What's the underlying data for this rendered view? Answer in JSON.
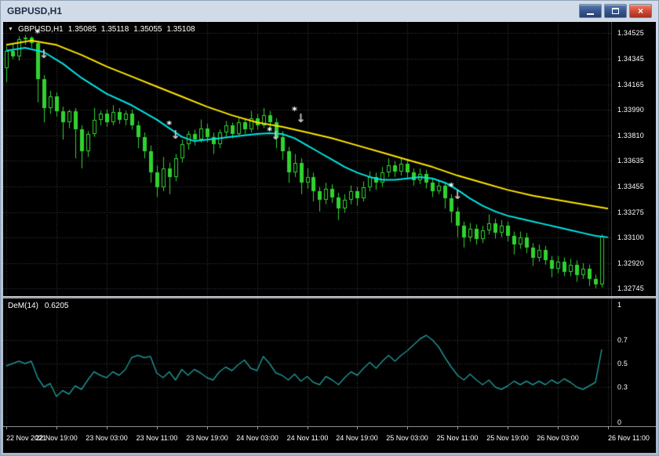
{
  "window": {
    "title": "GBPUSD,H1"
  },
  "icons": {
    "dropdown": "▼",
    "sell_arrow": "↓",
    "signal_star": "*",
    "close": "×"
  },
  "colors": {
    "chart_bg": "#000000",
    "grid": "#3f3f3f",
    "candle": "#30d230",
    "ma_slow": "#ffe400",
    "ma_fast": "#00e5e5",
    "arrow": "#c8c8c8",
    "star": "#ffffff",
    "dem_line": "#1f9090",
    "axis_text": "#ffffff"
  },
  "quote": {
    "symbol": "GBPUSD,H1",
    "open": "1.35085",
    "high": "1.35118",
    "low": "1.35055",
    "close": "1.35108"
  },
  "chart_data": {
    "bars_total": 97,
    "bars_per_label": 8,
    "x_labels": [
      "22 Nov 2021",
      "22 Nov 19:00",
      "23 Nov 03:00",
      "23 Nov 11:00",
      "23 Nov 19:00",
      "24 Nov 03:00",
      "24 Nov 11:00",
      "24 Nov 19:00",
      "25 Nov 03:00",
      "25 Nov 11:00",
      "25 Nov 19:00",
      "26 Nov 03:00",
      "26 Nov 11:00"
    ],
    "main": {
      "type": "candlestick",
      "symbol": "GBPUSD",
      "timeframe": "H1",
      "y_range": [
        1.3269,
        1.346
      ],
      "price_labels": [
        "1.34525",
        "1.34345",
        "1.34165",
        "1.33990",
        "1.33810",
        "1.33635",
        "1.33455",
        "1.33275",
        "1.33100",
        "1.32920",
        "1.32745"
      ],
      "candles": [
        [
          1.3428,
          1.3443,
          1.3418,
          1.344
        ],
        [
          1.344,
          1.3445,
          1.3434,
          1.3436
        ],
        [
          1.3436,
          1.345,
          1.3433,
          1.3448
        ],
        [
          1.3448,
          1.3451,
          1.3444,
          1.3449
        ],
        [
          1.3449,
          1.345,
          1.3442,
          1.3445
        ],
        [
          1.3445,
          1.3447,
          1.3404,
          1.342
        ],
        [
          1.342,
          1.3423,
          1.339,
          1.34
        ],
        [
          1.34,
          1.3412,
          1.3396,
          1.3408
        ],
        [
          1.3408,
          1.3411,
          1.3394,
          1.3398
        ],
        [
          1.3398,
          1.3401,
          1.3378,
          1.339
        ],
        [
          1.339,
          1.3399,
          1.3386,
          1.3398
        ],
        [
          1.3398,
          1.34,
          1.3365,
          1.3385
        ],
        [
          1.3385,
          1.3388,
          1.3358,
          1.337
        ],
        [
          1.337,
          1.3384,
          1.3366,
          1.3382
        ],
        [
          1.3382,
          1.34,
          1.338,
          1.3392
        ],
        [
          1.3392,
          1.3398,
          1.3388,
          1.3396
        ],
        [
          1.3396,
          1.3399,
          1.3387,
          1.339
        ],
        [
          1.339,
          1.3402,
          1.3388,
          1.3397
        ],
        [
          1.3397,
          1.34,
          1.3389,
          1.3392
        ],
        [
          1.3392,
          1.3398,
          1.3388,
          1.3396
        ],
        [
          1.3396,
          1.3399,
          1.3385,
          1.3388
        ],
        [
          1.3388,
          1.3391,
          1.3372,
          1.338
        ],
        [
          1.338,
          1.3383,
          1.3365,
          1.337
        ],
        [
          1.337,
          1.3374,
          1.3348,
          1.3355
        ],
        [
          1.3355,
          1.336,
          1.3338,
          1.3345
        ],
        [
          1.3345,
          1.3366,
          1.3342,
          1.3358
        ],
        [
          1.3358,
          1.3362,
          1.334,
          1.3352
        ],
        [
          1.3352,
          1.3368,
          1.3349,
          1.3365
        ],
        [
          1.3365,
          1.3378,
          1.3362,
          1.3375
        ],
        [
          1.3375,
          1.3384,
          1.3371,
          1.3382
        ],
        [
          1.3382,
          1.3385,
          1.3374,
          1.3378
        ],
        [
          1.3378,
          1.3392,
          1.3376,
          1.3386
        ],
        [
          1.3386,
          1.3389,
          1.3376,
          1.338
        ],
        [
          1.338,
          1.3383,
          1.3368,
          1.3375
        ],
        [
          1.3375,
          1.3385,
          1.3372,
          1.3383
        ],
        [
          1.3383,
          1.3391,
          1.338,
          1.3388
        ],
        [
          1.3388,
          1.339,
          1.3379,
          1.3382
        ],
        [
          1.3382,
          1.3393,
          1.338,
          1.339
        ],
        [
          1.339,
          1.3393,
          1.3382,
          1.3385
        ],
        [
          1.3385,
          1.3398,
          1.3383,
          1.3393
        ],
        [
          1.3393,
          1.3396,
          1.3385,
          1.3388
        ],
        [
          1.3388,
          1.34,
          1.3386,
          1.3395
        ],
        [
          1.3395,
          1.3398,
          1.3386,
          1.339
        ],
        [
          1.339,
          1.3393,
          1.3372,
          1.338
        ],
        [
          1.338,
          1.3384,
          1.3364,
          1.337
        ],
        [
          1.337,
          1.3373,
          1.3348,
          1.3355
        ],
        [
          1.3355,
          1.3368,
          1.3352,
          1.3362
        ],
        [
          1.3362,
          1.3365,
          1.334,
          1.3348
        ],
        [
          1.3348,
          1.3358,
          1.3344,
          1.3352
        ],
        [
          1.3352,
          1.3355,
          1.3335,
          1.3342
        ],
        [
          1.3342,
          1.3345,
          1.3328,
          1.3336
        ],
        [
          1.3336,
          1.3348,
          1.3333,
          1.3344
        ],
        [
          1.3344,
          1.3347,
          1.3334,
          1.3338
        ],
        [
          1.3338,
          1.3341,
          1.3322,
          1.333
        ],
        [
          1.333,
          1.334,
          1.3327,
          1.3336
        ],
        [
          1.3336,
          1.3346,
          1.3333,
          1.3342
        ],
        [
          1.3342,
          1.3345,
          1.3332,
          1.3337
        ],
        [
          1.3337,
          1.3349,
          1.3335,
          1.3345
        ],
        [
          1.3345,
          1.3356,
          1.3342,
          1.3352
        ],
        [
          1.3352,
          1.3355,
          1.3343,
          1.3348
        ],
        [
          1.3348,
          1.3359,
          1.3345,
          1.3355
        ],
        [
          1.3355,
          1.3365,
          1.3352,
          1.336
        ],
        [
          1.336,
          1.3363,
          1.3352,
          1.3356
        ],
        [
          1.3356,
          1.3365,
          1.3353,
          1.3361
        ],
        [
          1.3361,
          1.3364,
          1.3351,
          1.3355
        ],
        [
          1.3355,
          1.3358,
          1.3346,
          1.335
        ],
        [
          1.335,
          1.3358,
          1.3347,
          1.3354
        ],
        [
          1.3354,
          1.3357,
          1.3344,
          1.3348
        ],
        [
          1.3348,
          1.3351,
          1.3338,
          1.3342
        ],
        [
          1.3342,
          1.335,
          1.334,
          1.3346
        ],
        [
          1.3346,
          1.3348,
          1.333,
          1.3337
        ],
        [
          1.3337,
          1.334,
          1.332,
          1.3328
        ],
        [
          1.3328,
          1.3331,
          1.331,
          1.3318
        ],
        [
          1.3318,
          1.3321,
          1.3303,
          1.331
        ],
        [
          1.331,
          1.332,
          1.3307,
          1.3316
        ],
        [
          1.3316,
          1.3319,
          1.3305,
          1.3309
        ],
        [
          1.3309,
          1.3318,
          1.3306,
          1.3315
        ],
        [
          1.3315,
          1.3326,
          1.3312,
          1.332
        ],
        [
          1.332,
          1.3323,
          1.3309,
          1.3313
        ],
        [
          1.3313,
          1.3322,
          1.331,
          1.3318
        ],
        [
          1.3318,
          1.3321,
          1.3307,
          1.3311
        ],
        [
          1.3311,
          1.3314,
          1.3298,
          1.3305
        ],
        [
          1.3305,
          1.3314,
          1.3302,
          1.331
        ],
        [
          1.331,
          1.3313,
          1.3299,
          1.3303
        ],
        [
          1.3303,
          1.3306,
          1.329,
          1.3296
        ],
        [
          1.3296,
          1.3305,
          1.3293,
          1.3301
        ],
        [
          1.3301,
          1.3304,
          1.3291,
          1.3294
        ],
        [
          1.3294,
          1.3297,
          1.3282,
          1.3288
        ],
        [
          1.3288,
          1.3297,
          1.3285,
          1.3293
        ],
        [
          1.3293,
          1.3296,
          1.3283,
          1.3286
        ],
        [
          1.3286,
          1.3295,
          1.3283,
          1.3291
        ],
        [
          1.3291,
          1.3294,
          1.3279,
          1.3284
        ],
        [
          1.3284,
          1.3292,
          1.3281,
          1.3288
        ],
        [
          1.3288,
          1.3291,
          1.3276,
          1.3281
        ],
        [
          1.3281,
          1.3284,
          1.32745,
          1.3277
        ],
        [
          1.3277,
          1.3312,
          1.3275,
          1.33108
        ]
      ],
      "overlays": [
        {
          "name": "MA slow (yellow)",
          "color_key": "ma_slow",
          "points": [
            [
              0,
              1.3444
            ],
            [
              4,
              1.3447
            ],
            [
              8,
              1.3444
            ],
            [
              12,
              1.3437
            ],
            [
              16,
              1.3429
            ],
            [
              20,
              1.3422
            ],
            [
              24,
              1.3415
            ],
            [
              28,
              1.3408
            ],
            [
              32,
              1.3401
            ],
            [
              36,
              1.3395
            ],
            [
              40,
              1.339
            ],
            [
              44,
              1.3387
            ],
            [
              48,
              1.3383
            ],
            [
              52,
              1.3379
            ],
            [
              56,
              1.3374
            ],
            [
              60,
              1.3369
            ],
            [
              64,
              1.3364
            ],
            [
              68,
              1.3359
            ],
            [
              72,
              1.3353
            ],
            [
              76,
              1.3348
            ],
            [
              80,
              1.3343
            ],
            [
              84,
              1.3339
            ],
            [
              88,
              1.3336
            ],
            [
              92,
              1.3333
            ],
            [
              96,
              1.333
            ]
          ]
        },
        {
          "name": "MA fast (aqua)",
          "color_key": "ma_fast",
          "points": [
            [
              0,
              1.344
            ],
            [
              3,
              1.3442
            ],
            [
              6,
              1.3439
            ],
            [
              9,
              1.3431
            ],
            [
              12,
              1.3421
            ],
            [
              16,
              1.341
            ],
            [
              20,
              1.3402
            ],
            [
              24,
              1.3392
            ],
            [
              26,
              1.3386
            ],
            [
              28,
              1.338
            ],
            [
              30,
              1.3377
            ],
            [
              32,
              1.3378
            ],
            [
              34,
              1.3379
            ],
            [
              36,
              1.338
            ],
            [
              38,
              1.3381
            ],
            [
              40,
              1.3382
            ],
            [
              42,
              1.33825
            ],
            [
              44,
              1.3382
            ],
            [
              46,
              1.3379
            ],
            [
              48,
              1.3374
            ],
            [
              50,
              1.3369
            ],
            [
              52,
              1.3364
            ],
            [
              54,
              1.3359
            ],
            [
              56,
              1.3355
            ],
            [
              58,
              1.3352
            ],
            [
              60,
              1.335
            ],
            [
              62,
              1.335
            ],
            [
              64,
              1.3351
            ],
            [
              66,
              1.3352
            ],
            [
              68,
              1.3351
            ],
            [
              70,
              1.3348
            ],
            [
              72,
              1.3343
            ],
            [
              74,
              1.3337
            ],
            [
              76,
              1.3332
            ],
            [
              78,
              1.3328
            ],
            [
              80,
              1.3325
            ],
            [
              82,
              1.3323
            ],
            [
              84,
              1.3321
            ],
            [
              86,
              1.3319
            ],
            [
              88,
              1.3317
            ],
            [
              90,
              1.3315
            ],
            [
              92,
              1.3313
            ],
            [
              94,
              1.3311
            ],
            [
              96,
              1.331
            ]
          ]
        }
      ],
      "sell_arrows": [
        [
          6,
          1.3437
        ],
        [
          27,
          1.3381
        ],
        [
          43,
          1.338
        ],
        [
          47,
          1.3392
        ],
        [
          72,
          1.3339
        ]
      ],
      "stars": [
        [
          5,
          1.3452
        ],
        [
          26,
          1.3388
        ],
        [
          42,
          1.3384
        ],
        [
          46,
          1.3398
        ],
        [
          71,
          1.3345
        ]
      ]
    },
    "indicator": {
      "type": "line",
      "name": "DeM(14)",
      "value_text": "0.6205",
      "y_range": [
        0,
        1
      ],
      "axis_labels": [
        "1",
        "0.7",
        "0.5",
        "0.3",
        "0"
      ],
      "grid_levels": [
        0.7,
        0.5,
        0.3
      ],
      "values": [
        0.48,
        0.5,
        0.52,
        0.5,
        0.52,
        0.38,
        0.3,
        0.33,
        0.22,
        0.27,
        0.24,
        0.31,
        0.28,
        0.36,
        0.43,
        0.4,
        0.38,
        0.43,
        0.4,
        0.45,
        0.55,
        0.57,
        0.55,
        0.56,
        0.42,
        0.38,
        0.43,
        0.36,
        0.45,
        0.4,
        0.45,
        0.42,
        0.38,
        0.36,
        0.43,
        0.47,
        0.44,
        0.49,
        0.53,
        0.46,
        0.44,
        0.56,
        0.5,
        0.42,
        0.4,
        0.36,
        0.41,
        0.35,
        0.39,
        0.34,
        0.32,
        0.39,
        0.36,
        0.32,
        0.38,
        0.43,
        0.4,
        0.46,
        0.51,
        0.46,
        0.52,
        0.57,
        0.52,
        0.57,
        0.61,
        0.66,
        0.71,
        0.74,
        0.7,
        0.64,
        0.55,
        0.47,
        0.4,
        0.36,
        0.41,
        0.36,
        0.32,
        0.36,
        0.3,
        0.28,
        0.31,
        0.35,
        0.32,
        0.35,
        0.32,
        0.35,
        0.32,
        0.36,
        0.33,
        0.37,
        0.34,
        0.3,
        0.28,
        0.31,
        0.34,
        0.6205
      ]
    }
  }
}
